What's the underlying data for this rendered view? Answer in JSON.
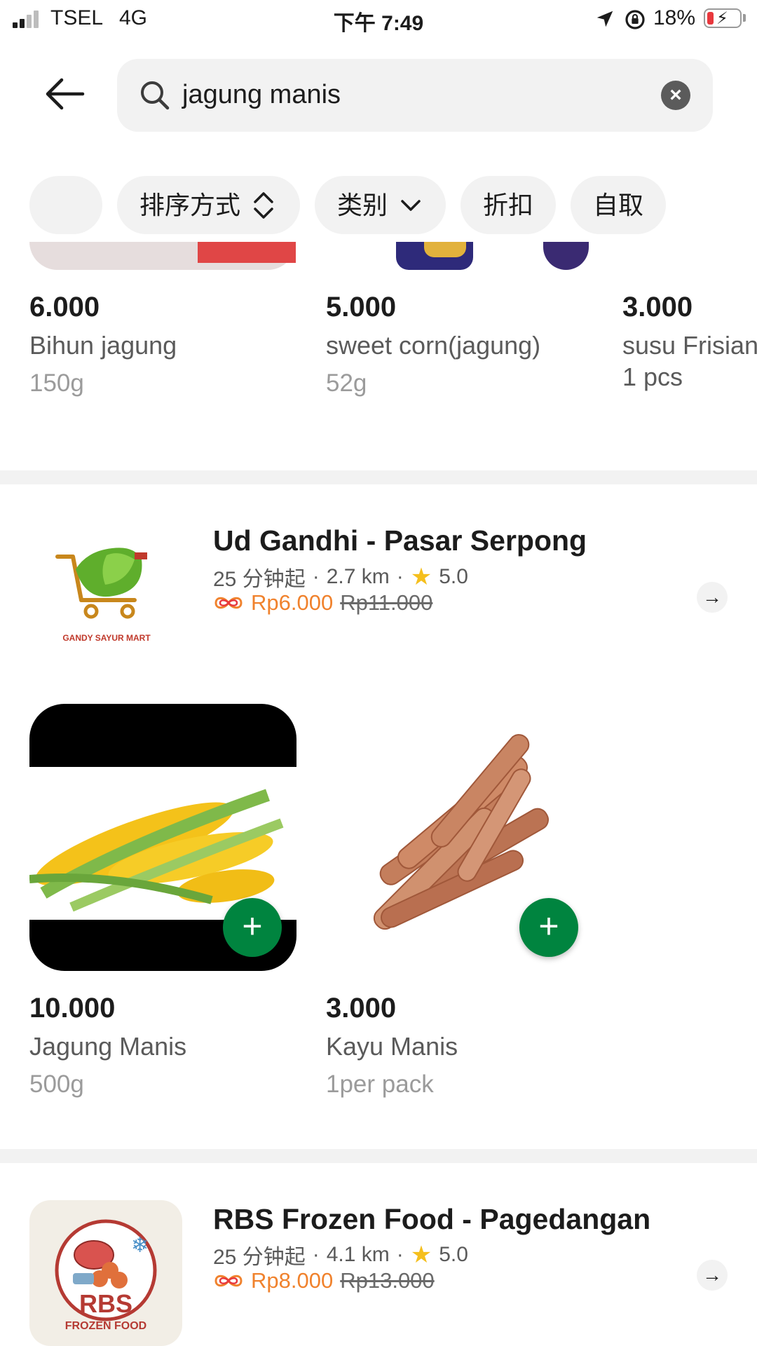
{
  "status_bar": {
    "carrier": "TSEL",
    "network": "4G",
    "time": "下午 7:49",
    "battery": "18%"
  },
  "search": {
    "query": "jagung manis",
    "clear_icon": "×"
  },
  "filters": {
    "sort": "排序方式",
    "category": "类别",
    "discount": "折扣",
    "pickup": "自取"
  },
  "top_products": [
    {
      "price": "6.000",
      "name": "Bihun jagung",
      "weight": "150g"
    },
    {
      "price": "5.000",
      "name": "sweet corn(jagung)",
      "weight": "52g"
    },
    {
      "price": "3.000",
      "name": "susu Frisian",
      "weight": "1 pcs"
    }
  ],
  "stores": [
    {
      "name": "Ud Gandhi - Pasar Serpong",
      "logo_text": "GANDY SAYUR MART",
      "eta": "25 分钟起",
      "distance": "2.7 km",
      "rating": "5.0",
      "promo_price": "Rp6.000",
      "original_price": "Rp11.000",
      "products": [
        {
          "price": "10.000",
          "name": "Jagung Manis",
          "weight": "500g"
        },
        {
          "price": "3.000",
          "name": "Kayu Manis",
          "weight": "1per pack"
        }
      ]
    },
    {
      "name": "RBS Frozen Food - Pagedangan",
      "logo_text": "RBS",
      "logo_subtext": "FROZEN FOOD",
      "eta": "25 分钟起",
      "distance": "4.1 km",
      "rating": "5.0",
      "promo_price": "Rp8.000",
      "original_price": "Rp13.000"
    }
  ],
  "colors": {
    "accent_green": "#00843f",
    "promo_orange": "#f0822d",
    "rating_star": "#f5bf1d"
  },
  "icons": [
    "back-arrow-icon",
    "search-icon",
    "clear-icon",
    "sort-icon",
    "chevron-down-icon",
    "add-icon",
    "arrow-right-icon",
    "star-icon",
    "location-arrow-icon",
    "rotation-lock-icon",
    "battery-icon",
    "signal-icon"
  ]
}
